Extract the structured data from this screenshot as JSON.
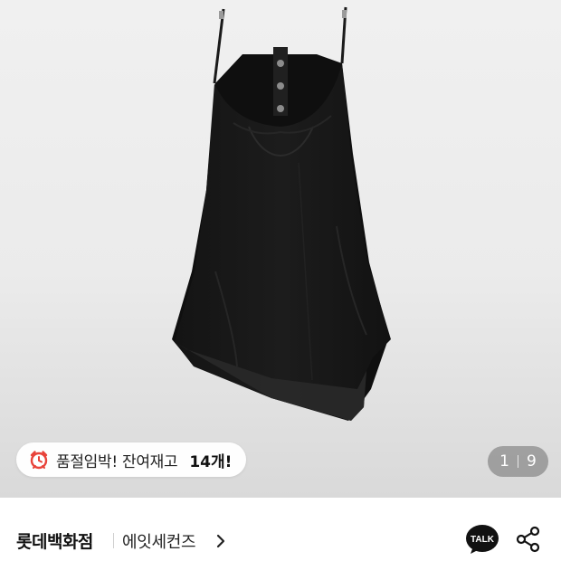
{
  "stock_notice": {
    "icon": "alarm-clock-icon",
    "message": "품절임박! 잔여재고",
    "count": "14개!"
  },
  "image_pager": {
    "current": "1",
    "total": "9"
  },
  "brand": {
    "store": "롯데백화점",
    "seller": "에잇세컨즈"
  },
  "actions": {
    "talk_label": "TALK",
    "share_icon": "share-icon"
  },
  "colors": {
    "alarm_red": "#e8433a",
    "talk_black": "#111111"
  }
}
